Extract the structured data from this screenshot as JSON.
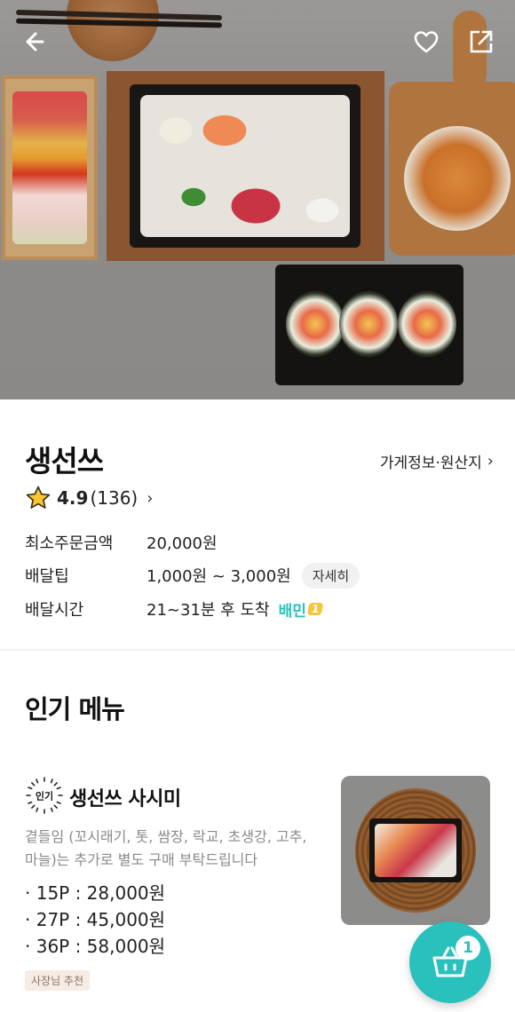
{
  "store": {
    "name": "생선쓰",
    "info_link": "가게정보·원산지",
    "rating": "4.9",
    "review_count": "(136)"
  },
  "details": [
    {
      "label": "최소주문금액",
      "value": "20,000원"
    },
    {
      "label": "배달팁",
      "value": "1,000원 ~ 3,000원",
      "button": "자세히"
    },
    {
      "label": "배달시간",
      "value": "21~31분 후 도착",
      "badge": "배민",
      "badge_num": "1"
    }
  ],
  "section": {
    "title": "인기 메뉴"
  },
  "menu": {
    "badge": "인기",
    "name": "생선쓰 사시미",
    "description": "곁들임 (꼬시래기, 톳, 쌈장, 락교, 초생강, 고추, 마늘)는  추가로  별도 구매  부탁드립니다",
    "prices": [
      "· 15P : 28,000원",
      "· 27P : 45,000원",
      "· 36P : 58,000원"
    ],
    "tag": "사장님 추천"
  },
  "cart": {
    "count": "1"
  },
  "icons": {
    "back": "back-arrow-icon",
    "favorite": "heart-icon",
    "share": "share-icon",
    "rating": "star-icon",
    "cart": "basket-icon"
  },
  "colors": {
    "accent": "#2ac1bc",
    "star": "#f7c531"
  }
}
